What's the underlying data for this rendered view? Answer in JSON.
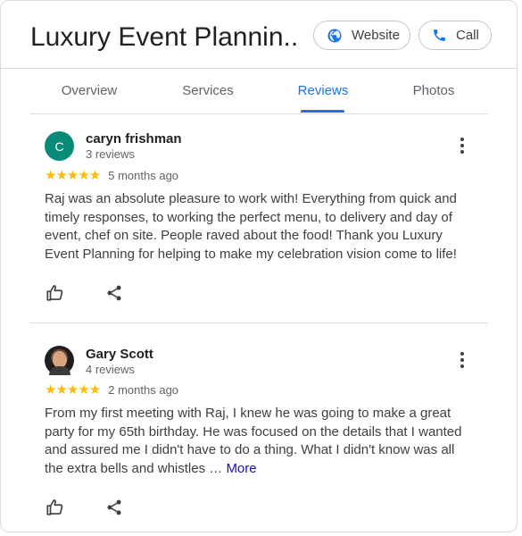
{
  "header": {
    "business_name": "Luxury Event Plannin...",
    "website_button": {
      "label": "Website",
      "icon": "globe-icon"
    },
    "call_button": {
      "label": "Call",
      "icon": "phone-icon"
    }
  },
  "tabs": [
    {
      "label": "Overview",
      "active": false
    },
    {
      "label": "Services",
      "active": false
    },
    {
      "label": "Reviews",
      "active": true
    },
    {
      "label": "Photos",
      "active": false
    }
  ],
  "reviews": [
    {
      "avatar_letter": "C",
      "avatar_color": "#078a78",
      "name": "caryn frishman",
      "review_count": "3 reviews",
      "stars": "★★★★★",
      "rating": 5,
      "time_ago": "5 months ago",
      "text": "Raj was an absolute pleasure to work with! Everything from quick and timely responses, to working the perfect menu, to delivery and day of event, chef on site. People raved about the food! Thank you Luxury Event Planning for helping to make my celebration vision come to life!",
      "more_label": ""
    },
    {
      "avatar_letter": "",
      "name": "Gary Scott",
      "review_count": "4 reviews",
      "stars": "★★★★★",
      "rating": 5,
      "time_ago": "2 months ago",
      "text": "From my first meeting with Raj, I knew he was going to make a great party for my 65th birthday. He was focused on the details that I wanted and assured me I didn't have to do a thing. What I didn't know was all the extra bells and whistles … ",
      "more_label": "More"
    }
  ],
  "colors": {
    "accent": "#1a73e8",
    "star": "#fbbc04",
    "link": "#1a0dab",
    "divider": "#dadce0"
  }
}
